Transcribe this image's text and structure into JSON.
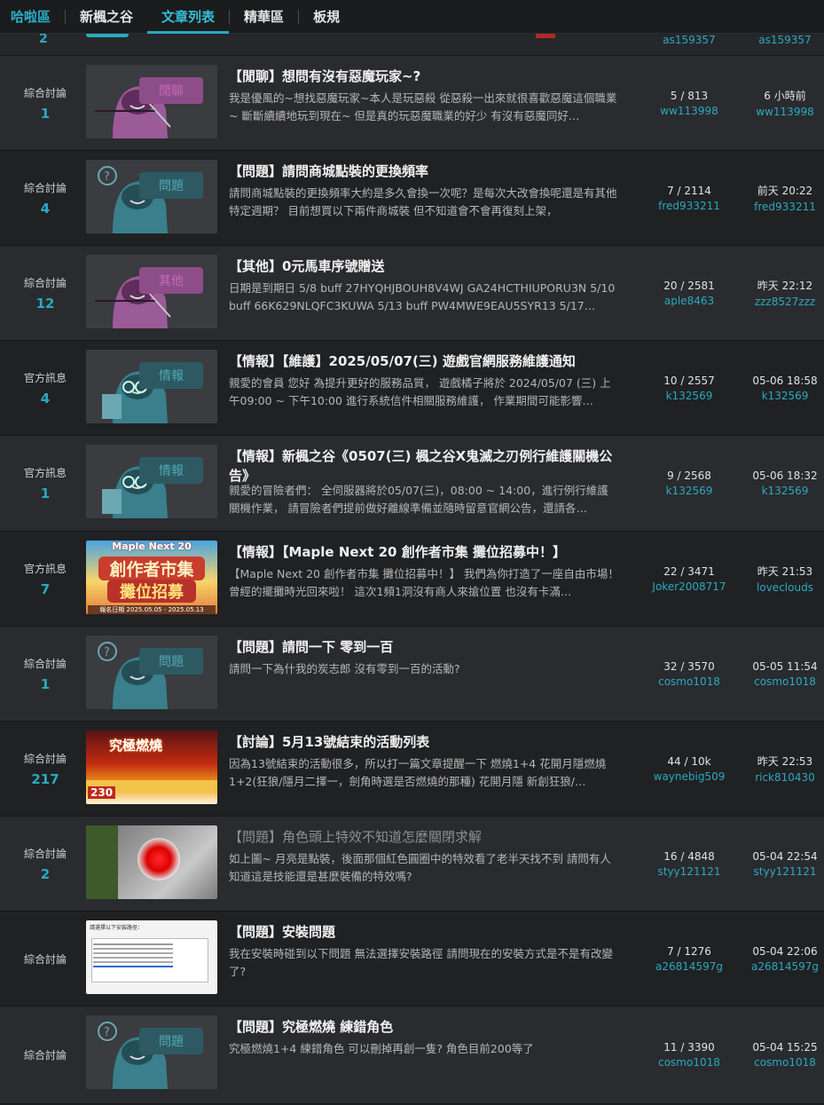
{
  "nav": {
    "brand": "哈啦區",
    "items": [
      "新楓之谷",
      "文章列表",
      "精華區",
      "板規"
    ],
    "active": "文章列表"
  },
  "partial_row": {
    "count": "2",
    "last_user_a": "as159357",
    "last_user_b": "as159357"
  },
  "rows": [
    {
      "board": "綜合討論",
      "count": "1",
      "thumb": "chat",
      "thumb_label": "閒聊",
      "title": "【閒聊】想問有沒有惡魔玩家~?",
      "snippet": "我是優風的~想找惡魔玩家~本人是玩惡殺 從惡殺一出來就很喜歡惡魔這個職業~ 斷斷續續地玩到現在~ 但是真的玩惡魔職業的好少 有沒有惡魔同好…",
      "stats": "5 / 813",
      "author": "ww113998",
      "last_time": "6 小時前",
      "last_user": "ww113998"
    },
    {
      "board": "綜合討論",
      "count": "4",
      "thumb": "q",
      "thumb_label": "問題",
      "title": "【問題】請問商城點裝的更換頻率",
      "snippet": "請問商城點裝的更換頻率大約是多久會換一次呢？是每次大改會換呢還是有其他特定週期？ 目前想買以下兩件商城裝 但不知道會不會再復刻上架，",
      "stats": "7 / 2114",
      "author": "fred933211",
      "last_time": "前天 20:22",
      "last_user": "fred933211"
    },
    {
      "board": "綜合討論",
      "count": "12",
      "thumb": "chat",
      "thumb_label": "其他",
      "title": "【其他】0元馬車序號贈送",
      "snippet": "日期是到期日 5/8 buff 27HYQHJBOUH8V4WJ GA24HCTHIUPORU3N 5/10 buff 66K629NLQFC3KUWA 5/13 buff PW4MWE9EAU5SYR13 5/17…",
      "stats": "20 / 2581",
      "author": "aple8463",
      "last_time": "昨天 22:12",
      "last_user": "zzz8527zzz"
    },
    {
      "board": "官方訊息",
      "count": "4",
      "thumb": "info",
      "thumb_label": "情報",
      "title": "【情報】【維護】2025/05/07(三) 遊戲官網服務維護通知",
      "snippet": "親愛的會員 您好 為提升更好的服務品質， 遊戲橘子將於 2024/05/07 (三) 上午09:00 ~ 下午10:00 進行系統信件相關服務維護， 作業期間可能影響…",
      "stats": "10 / 2557",
      "author": "k132569",
      "last_time": "05-06 18:58",
      "last_user": "k132569"
    },
    {
      "board": "官方訊息",
      "count": "1",
      "thumb": "info",
      "thumb_label": "情報",
      "title": "【情報】新楓之谷《0507(三) 楓之谷X鬼滅之刃例行維護關機公告》",
      "snippet": "親愛的冒險者們： 全伺服器將於05/07(三)，08:00 ~ 14:00，進行例行維護關機作業， 請冒險者們提前做好離線準備並隨時留意官網公告，還請各…",
      "stats": "9 / 2568",
      "author": "k132569",
      "last_time": "05-06 18:32",
      "last_user": "k132569",
      "tall": true
    },
    {
      "board": "官方訊息",
      "count": "7",
      "thumb": "maple",
      "thumb_label": "",
      "thumb_text": [
        "Maple Next 20",
        "創作者市集",
        "攤位招募",
        "報名日期 2025.05.05 - 2025.05.13"
      ],
      "title": "【情報】【Maple Next 20 創作者市集 攤位招募中！】",
      "snippet": "【Maple Next 20 創作者市集 攤位招募中！】 我們為你打造了一座自由市場！ 曾經的擺攤時光回來啦！ 這次1頻1洞沒有商人來搶位置 也沒有卡滿…",
      "stats": "22 / 3471",
      "author": "Joker2008717",
      "last_time": "昨天 21:53",
      "last_user": "loveclouds"
    },
    {
      "board": "綜合討論",
      "count": "1",
      "thumb": "q",
      "thumb_label": "問題",
      "title": "【問題】請問一下 零到一百",
      "snippet": "請問一下為什我的炭志郎 沒有零到一百的活動?",
      "stats": "32 / 3570",
      "author": "cosmo1018",
      "last_time": "05-05 11:54",
      "last_user": "cosmo1018"
    },
    {
      "board": "綜合討論",
      "count": "217",
      "thumb": "burn",
      "thumb_label": "",
      "thumb_text": [
        "究極燃燒",
        "230"
      ],
      "title": "【討論】5月13號結束的活動列表",
      "snippet": "因為13號結束的活動很多，所以打一篇文章提醒一下 燃燒1+4 花開月隱燃燒1+2(狂狼/隱月二擇一，劍角時選是否燃燒的那種) 花開月隱 新創狂狼/…",
      "stats": "44 / 10k",
      "author": "waynebig509",
      "last_time": "昨天 22:53",
      "last_user": "rick810430"
    },
    {
      "board": "綜合討論",
      "count": "2",
      "thumb": "shot",
      "thumb_label": "",
      "title": "【問題】角色頭上特效不知道怎麼關閉求解",
      "dim": true,
      "snippet": "如上圖~ 月亮是點裝，後面那個紅色圓圈中的特效看了老半天找不到 請問有人知道這是技能還是甚麼裝備的特效嗎?",
      "stats": "16 / 4848",
      "author": "styy121121",
      "last_time": "05-04 22:54",
      "last_user": "styy121121"
    },
    {
      "board": "綜合討論",
      "count": "",
      "thumb": "doc",
      "thumb_label": "",
      "thumb_text": [
        "請選擇以下安裝路徑："
      ],
      "title": "【問題】安裝問題",
      "snippet": "我在安裝時碰到以下問題 無法選擇安裝路徑 請問現在的安裝方式是不是有改變了?",
      "stats": "7 / 1276",
      "author": "a26814597g",
      "last_time": "05-04 22:06",
      "last_user": "a26814597g"
    },
    {
      "board": "綜合討論",
      "count": "",
      "thumb": "q",
      "thumb_label": "問題",
      "title": "【問題】究極燃燒 練錯角色",
      "snippet": "究極燃燒1+4 練錯角色 可以刪掉再創一隻? 角色目前200等了",
      "stats": "11 / 3390",
      "author": "cosmo1018",
      "last_time": "05-04 15:25",
      "last_user": "cosmo1018"
    }
  ]
}
